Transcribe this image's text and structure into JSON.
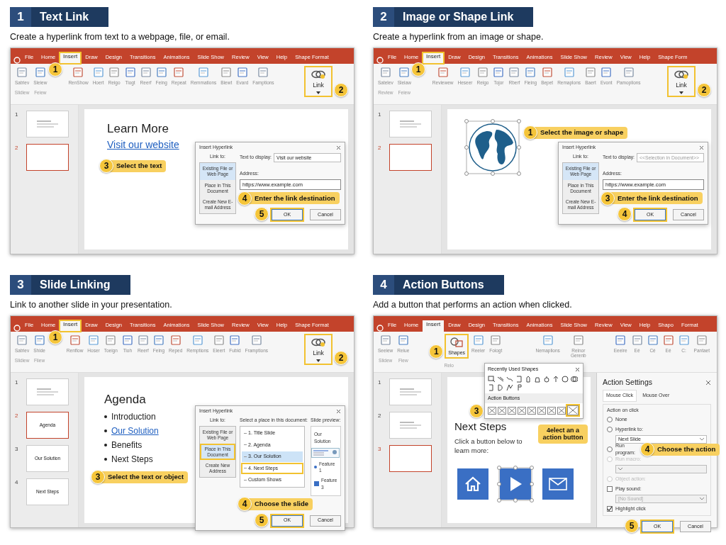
{
  "panels": [
    {
      "number": "1",
      "title": "Text Link",
      "description": "Create a hyperlink from text to a webpage, file, or email.",
      "app": {
        "tabs": [
          {
            "label": "File",
            "selected": false,
            "highlighted": false
          },
          {
            "label": "Home",
            "selected": false,
            "highlighted": false
          },
          {
            "label": "Insert",
            "selected": true,
            "highlighted": true,
            "step": "1"
          },
          {
            "label": "Draw",
            "selected": false,
            "highlighted": false
          },
          {
            "label": "Design",
            "selected": false,
            "highlighted": false
          },
          {
            "label": "Transitions",
            "selected": false,
            "highlighted": false
          },
          {
            "label": "Animations",
            "selected": false,
            "highlighted": false
          },
          {
            "label": "Slide Show",
            "selected": false,
            "highlighted": false
          },
          {
            "label": "Review",
            "selected": false,
            "highlighted": false
          },
          {
            "label": "View",
            "selected": false,
            "highlighted": false
          },
          {
            "label": "Help",
            "selected": false,
            "highlighted": false
          },
          {
            "label": "Shape Format",
            "selected": false,
            "highlighted": false
          }
        ],
        "ribbon": [
          {
            "kind": "button",
            "label": "Satriev",
            "sub": "Slidiew",
            "highlighted": false
          },
          {
            "kind": "button",
            "label": "Sleiew",
            "sub": "Feiew",
            "highlighted": false
          },
          {
            "kind": "button",
            "label": "RenShow",
            "highlighted": false
          },
          {
            "kind": "button",
            "label": "Hoert",
            "highlighted": false
          },
          {
            "kind": "button",
            "label": "Reigo",
            "highlighted": false
          },
          {
            "kind": "button",
            "label": "Tiogt",
            "highlighted": false
          },
          {
            "kind": "button",
            "label": "Reerf",
            "highlighted": false
          },
          {
            "kind": "button",
            "label": "Feing",
            "highlighted": false
          },
          {
            "kind": "button",
            "label": "Repeat",
            "highlighted": false
          },
          {
            "kind": "button",
            "label": "Remmations",
            "highlighted": false
          },
          {
            "kind": "button",
            "label": "Biewt",
            "highlighted": false
          },
          {
            "kind": "button",
            "label": "Evard",
            "highlighted": false
          },
          {
            "kind": "button",
            "label": "Famptions",
            "highlighted": false
          }
        ],
        "ribbon_right": [
          {
            "kind": "link",
            "label": "Link",
            "highlighted": true,
            "step": "2"
          }
        ],
        "slides": [
          {
            "number": "1",
            "selected": false,
            "kind": "scribble"
          },
          {
            "number": "2",
            "selected": true,
            "kind": "blank"
          }
        ],
        "slide": {
          "kind": "link-text",
          "title": "Learn More",
          "link": "Visit our website",
          "callout": {
            "step": "3",
            "text": "Select the text"
          }
        },
        "dialog": {
          "kind": "hyperlink",
          "title": "Insert Hyperlink",
          "link_to": "Link to:",
          "options": [
            {
              "label": "Existing File or Web Page",
              "selected": true,
              "highlighted": false
            },
            {
              "label": "Place in This Document",
              "selected": false,
              "highlighted": false
            },
            {
              "label": "Create New E-mail Address",
              "selected": false,
              "highlighted": false
            }
          ],
          "display_label": "Text to display:",
          "display_value": "Visit our website",
          "address_label": "Address:",
          "address_value": "https://www.example.com",
          "callout": {
            "step": "4",
            "text": "Enter the link destination"
          },
          "ok": {
            "label": "OK",
            "step": "5"
          },
          "cancel": "Cancel"
        }
      }
    },
    {
      "number": "2",
      "title": "Image or Shape Link",
      "description": "Create a hyperlink from an image or shape.",
      "app": {
        "tabs": [
          {
            "label": "File",
            "selected": false,
            "highlighted": false
          },
          {
            "label": "Home",
            "selected": false,
            "highlighted": false
          },
          {
            "label": "Insert",
            "selected": true,
            "highlighted": true,
            "step": "1"
          },
          {
            "label": "Draw",
            "selected": false,
            "highlighted": false
          },
          {
            "label": "Design",
            "selected": false,
            "highlighted": false
          },
          {
            "label": "Transitions",
            "selected": false,
            "highlighted": false
          },
          {
            "label": "Animations",
            "selected": false,
            "highlighted": false
          },
          {
            "label": "Slide Show",
            "selected": false,
            "highlighted": false
          },
          {
            "label": "Review",
            "selected": false,
            "highlighted": false
          },
          {
            "label": "View",
            "selected": false,
            "highlighted": false
          },
          {
            "label": "Help",
            "selected": false,
            "highlighted": false
          },
          {
            "label": "Shape Form",
            "selected": false,
            "highlighted": false
          }
        ],
        "ribbon": [
          {
            "kind": "button",
            "label": "Satelev",
            "sub": "Review",
            "highlighted": false
          },
          {
            "kind": "button",
            "label": "Sleiaw",
            "sub": "Feiew",
            "highlighted": false
          },
          {
            "kind": "button",
            "label": "Reviewew",
            "highlighted": false
          },
          {
            "kind": "button",
            "label": "Heseer",
            "highlighted": false
          },
          {
            "kind": "button",
            "label": "Reigo",
            "highlighted": false
          },
          {
            "kind": "button",
            "label": "Tojor",
            "highlighted": false
          },
          {
            "kind": "button",
            "label": "Rberf",
            "highlighted": false
          },
          {
            "kind": "button",
            "label": "Fleing",
            "highlighted": false
          },
          {
            "kind": "button",
            "label": "Bepet",
            "highlighted": false
          },
          {
            "kind": "button",
            "label": "Remaplons",
            "highlighted": false
          },
          {
            "kind": "button",
            "label": "Baert",
            "highlighted": false
          },
          {
            "kind": "button",
            "label": "Evont",
            "highlighted": false
          },
          {
            "kind": "button",
            "label": "Pamoplions",
            "highlighted": false
          }
        ],
        "ribbon_right": [
          {
            "kind": "link",
            "label": "Link",
            "highlighted": true,
            "step": "2"
          }
        ],
        "slides": [
          {
            "number": "1",
            "selected": false,
            "kind": "scribble"
          },
          {
            "number": "2",
            "selected": true,
            "kind": "blank"
          }
        ],
        "slide": {
          "kind": "image",
          "selected": true,
          "callout": {
            "step": "1",
            "text": "Select the image or shape"
          }
        },
        "dialog": {
          "kind": "hyperlink",
          "title": "Insert Hyperlink",
          "link_to": "Link to:",
          "options": [
            {
              "label": "Existing File or Web Page",
              "selected": true,
              "highlighted": false
            },
            {
              "label": "Place in This Document",
              "selected": false,
              "highlighted": false
            },
            {
              "label": "Create New E-mail Address",
              "selected": false,
              "highlighted": false
            }
          ],
          "display_label": "Text to display:",
          "display_placeholder": "<<Selection in Document>>",
          "address_label": "Address:",
          "address_value": "https://www.example.com",
          "callout": {
            "step": "3",
            "text": "Enter the link destination"
          },
          "ok": {
            "label": "OK",
            "step": "4"
          },
          "cancel": "Cancel"
        }
      }
    },
    {
      "number": "3",
      "title": "Slide Linking",
      "description": "Link to another slide in your presentation.",
      "app": {
        "tabs": [
          {
            "label": "File",
            "selected": false,
            "highlighted": false
          },
          {
            "label": "Home",
            "selected": false,
            "highlighted": false
          },
          {
            "label": "Insert",
            "selected": true,
            "highlighted": true,
            "step": "1"
          },
          {
            "label": "Draw",
            "selected": false,
            "highlighted": false
          },
          {
            "label": "Design",
            "selected": false,
            "highlighted": false
          },
          {
            "label": "Transitions",
            "selected": false,
            "highlighted": false
          },
          {
            "label": "Animations",
            "selected": false,
            "highlighted": false
          },
          {
            "label": "Slide Show",
            "selected": false,
            "highlighted": false
          },
          {
            "label": "Review",
            "selected": false,
            "highlighted": false
          },
          {
            "label": "View",
            "selected": false,
            "highlighted": false
          },
          {
            "label": "Help",
            "selected": false,
            "highlighted": false
          },
          {
            "label": "Shape Format",
            "selected": false,
            "highlighted": false
          }
        ],
        "ribbon": [
          {
            "kind": "button",
            "label": "Satriev",
            "sub": "Slidiew",
            "highlighted": false
          },
          {
            "kind": "button",
            "label": "Shide",
            "sub": "Fiiew",
            "highlighted": false
          },
          {
            "kind": "button",
            "label": "Renflow",
            "highlighted": false
          },
          {
            "kind": "button",
            "label": "Hoser",
            "highlighted": false
          },
          {
            "kind": "button",
            "label": "Toeign",
            "highlighted": false
          },
          {
            "kind": "button",
            "label": "Tioh",
            "highlighted": false
          },
          {
            "kind": "button",
            "label": "Reerf",
            "highlighted": false
          },
          {
            "kind": "button",
            "label": "Feing",
            "highlighted": false
          },
          {
            "kind": "button",
            "label": "Reped",
            "highlighted": false
          },
          {
            "kind": "button",
            "label": "Remptions",
            "highlighted": false
          },
          {
            "kind": "button",
            "label": "Eieert",
            "highlighted": false
          },
          {
            "kind": "button",
            "label": "Fubid",
            "highlighted": false
          },
          {
            "kind": "button",
            "label": "Framptions",
            "highlighted": false
          }
        ],
        "ribbon_right": [
          {
            "kind": "link",
            "label": "Link",
            "highlighted": true,
            "step": "2"
          }
        ],
        "slides": [
          {
            "number": "1",
            "selected": false,
            "kind": "scribble"
          },
          {
            "number": "2",
            "selected": true,
            "kind": "label",
            "label": "Agenda"
          },
          {
            "number": "3",
            "selected": false,
            "kind": "label",
            "label": "Our Solution"
          },
          {
            "number": "4",
            "selected": false,
            "kind": "label",
            "label": "Next Steps"
          }
        ],
        "slide": {
          "kind": "bullets",
          "title": "Agenda",
          "items": [
            {
              "label": "Introduction",
              "link": false
            },
            {
              "label": "Our Solution",
              "link": true
            },
            {
              "label": "Benefits",
              "link": false
            },
            {
              "label": "Next Steps",
              "link": false
            }
          ],
          "callout": {
            "step": "3",
            "text": "Select the text or object"
          }
        },
        "dialog": {
          "kind": "place",
          "title": "Insert Hyperlink",
          "link_to": "Link to:",
          "options": [
            {
              "label": "Existing File or Web Page",
              "selected": false,
              "highlighted": false
            },
            {
              "label": "Place in This Document",
              "selected": true,
              "highlighted": true
            },
            {
              "label": "Create New Address",
              "selected": false,
              "highlighted": false
            }
          ],
          "place_label": "Select a place in this document:",
          "places": [
            {
              "label": "1. Title Slide",
              "selected": false,
              "highlighted": false
            },
            {
              "label": "2. Agenda",
              "selected": false,
              "highlighted": false
            },
            {
              "label": "3. Our Solution",
              "selected": true,
              "highlighted": false
            },
            {
              "label": "4. Next Steps",
              "selected": false,
              "highlighted": true
            },
            {
              "label": "Custom Shows",
              "selected": false,
              "highlighted": false
            }
          ],
          "preview_label": "Slide preview:",
          "preview": {
            "title": "Our Solution",
            "items": [
              "Feature 1",
              "Feature 3"
            ]
          },
          "callout": {
            "step": "4",
            "text": "Choose the slide"
          },
          "ok": {
            "label": "OK",
            "step": "5"
          },
          "cancel": "Cancel"
        }
      }
    },
    {
      "number": "4",
      "title": "Action Buttons",
      "description": "Add a button that performs an action when clicked.",
      "app": {
        "tabs": [
          {
            "label": "File",
            "selected": false,
            "highlighted": false
          },
          {
            "label": "Home",
            "selected": false,
            "highlighted": false
          },
          {
            "label": "Insert",
            "selected": true,
            "highlighted": false
          },
          {
            "label": "Draw",
            "selected": false,
            "highlighted": false
          },
          {
            "label": "Design",
            "selected": false,
            "highlighted": false
          },
          {
            "label": "Transitions",
            "selected": false,
            "highlighted": false
          },
          {
            "label": "Animations",
            "selected": false,
            "highlighted": false
          },
          {
            "label": "Slide Show",
            "selected": false,
            "highlighted": false
          },
          {
            "label": "Review",
            "selected": false,
            "highlighted": false
          },
          {
            "label": "View",
            "selected": false,
            "highlighted": false
          },
          {
            "label": "Help",
            "selected": false,
            "highlighted": false
          },
          {
            "label": "Shapo",
            "selected": false,
            "highlighted": false
          },
          {
            "label": "Format",
            "selected": false,
            "highlighted": false
          }
        ],
        "ribbon": [
          {
            "kind": "button",
            "label": "Seeiew",
            "sub": "Slidew",
            "highlighted": false
          },
          {
            "kind": "button",
            "label": "Reiue",
            "sub": "Fiew",
            "highlighted": false
          },
          {
            "kind": "shapes",
            "label": "Shapes",
            "sub": "Relo",
            "highlighted": true,
            "step": "1"
          },
          {
            "kind": "button",
            "label": "Reeier",
            "highlighted": false
          },
          {
            "kind": "button",
            "label": "Foiogt",
            "highlighted": false
          }
        ],
        "ribbon_right": [
          {
            "kind": "button",
            "label": "Nemaplions",
            "highlighted": false
          },
          {
            "kind": "button",
            "label": "Reinor Gerenb",
            "highlighted": false
          },
          {
            "kind": "button",
            "label": "Eeeire",
            "highlighted": false
          },
          {
            "kind": "button",
            "label": "Eé",
            "highlighted": false
          },
          {
            "kind": "button",
            "label": "Cé",
            "highlighted": false
          },
          {
            "kind": "button",
            "label": "Eé",
            "highlighted": false
          },
          {
            "kind": "button",
            "label": "C:",
            "highlighted": false
          },
          {
            "kind": "button",
            "label": "Pantaet",
            "highlighted": false
          }
        ],
        "slides": [
          {
            "number": "1",
            "selected": false,
            "kind": "scribble"
          },
          {
            "number": "2",
            "selected": false,
            "kind": "scribble"
          },
          {
            "number": "3",
            "selected": true,
            "kind": "blank"
          }
        ],
        "gallery": {
          "title": "Recently Used Shapes",
          "section": "Action Buttons",
          "step": "3",
          "buttons": [
            {
              "highlighted": false
            },
            {
              "highlighted": false
            },
            {
              "highlighted": false
            },
            {
              "highlighted": false
            },
            {
              "highlighted": false
            },
            {
              "highlighted": false
            },
            {
              "highlighted": false
            },
            {
              "highlighted": false
            },
            {
              "highlighted": true
            }
          ],
          "callout": {
            "text": "4elect an a action button"
          }
        },
        "slide": {
          "kind": "buttons",
          "title": "Next Steps",
          "text": "Click a button below to learn more:",
          "buttons": [
            {
              "kind": "home",
              "selected": false
            },
            {
              "kind": "play",
              "selected": true
            },
            {
              "kind": "mail",
              "selected": false
            }
          ]
        },
        "pane": {
          "kind": "action-settings",
          "title": "Action Settings",
          "tabs": [
            {
              "label": "Mouse Click",
              "selected": true
            },
            {
              "label": "Mouse Over",
              "selected": false
            }
          ],
          "section": "Action on click",
          "options": [
            {
              "kind": "radio",
              "label": "None",
              "checked": false,
              "disabled": false
            },
            {
              "kind": "radio",
              "label": "Hyperlink to:",
              "checked": false,
              "disabled": false
            },
            {
              "kind": "select",
              "value": "Next Slide",
              "disabled": false
            },
            {
              "kind": "radio",
              "label": "Run program:",
              "checked": false,
              "disabled": false,
              "callout": {
                "step": "4",
                "text": "Choose the action"
              }
            },
            {
              "kind": "radio",
              "label": "Run macro:",
              "checked": false,
              "disabled": true
            },
            {
              "kind": "select",
              "disabled": true
            },
            {
              "kind": "radio",
              "label": "Object action:",
              "checked": false,
              "disabled": true
            },
            {
              "kind": "checkbox",
              "label": "Play sound:",
              "checked": false,
              "disabled": false
            },
            {
              "kind": "select",
              "value": "[No Sound]",
              "disabled": true
            },
            {
              "kind": "checkbox",
              "label": "Highlight click",
              "checked": true,
              "disabled": false
            }
          ],
          "ok": {
            "label": "OK",
            "step": "5"
          },
          "cancel": "Cancel"
        }
      }
    }
  ]
}
